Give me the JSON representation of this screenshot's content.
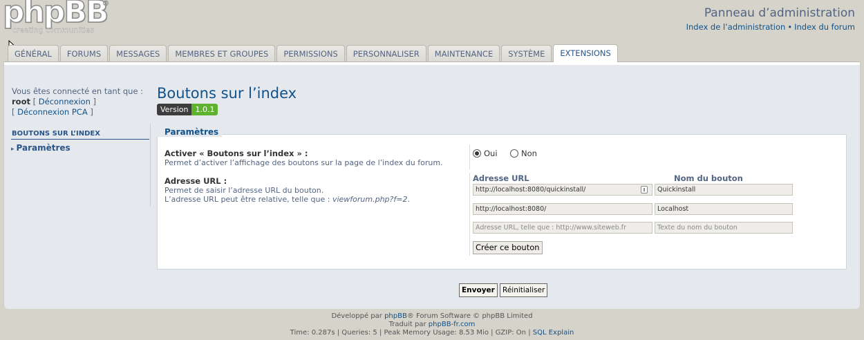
{
  "header": {
    "logo_text": "phpBB",
    "logo_reg": "®",
    "logo_tagline": "creating  communities",
    "title": "Panneau d’administration",
    "links": [
      "Index de l’administration",
      "Index du forum"
    ],
    "link_sep": "•"
  },
  "tabs": [
    {
      "label": "GÉNÉRAL",
      "active": false
    },
    {
      "label": "FORUMS",
      "active": false
    },
    {
      "label": "MESSAGES",
      "active": false
    },
    {
      "label": "MEMBRES ET GROUPES",
      "active": false
    },
    {
      "label": "PERMISSIONS",
      "active": false
    },
    {
      "label": "PERSONNALISER",
      "active": false
    },
    {
      "label": "MAINTENANCE",
      "active": false
    },
    {
      "label": "SYSTÈME",
      "active": false
    },
    {
      "label": "EXTENSIONS",
      "active": true
    }
  ],
  "sidebar": {
    "connected_as": "Vous êtes connecté en tant que :",
    "username": "root",
    "logout": "Déconnexion",
    "logout_acp": "Déconnexion PCA",
    "menu_title": "BOUTONS SUR L’INDEX",
    "menu_item": "Paramètres"
  },
  "main": {
    "title": "Boutons sur l’index",
    "version_label": "Version",
    "version_number": "1.0.1",
    "legend": "Paramètres",
    "enable": {
      "label": "Activer « Boutons sur l’index » :",
      "explain": "Permet d’activer l’affichage des boutons sur la page de l’index du forum.",
      "options": [
        "Oui",
        "Non"
      ],
      "selected": "Oui"
    },
    "url": {
      "label": "Adresse URL :",
      "explain_1": "Permet de saisir l’adresse URL du bouton.",
      "explain_2": "L’adresse URL peut être relative, telle que :",
      "explain_example": "viewforum.php?f=2",
      "explain_end": "."
    },
    "columns": {
      "url": "Adresse URL",
      "name": "Nom du bouton"
    },
    "rows": [
      {
        "url": "http://localhost:8080/quickinstall/",
        "name": "Quickinstall"
      },
      {
        "url": "http://localhost:8080/",
        "name": "Localhost"
      }
    ],
    "placeholders": {
      "url": "Adresse URL, telle que : http://www.siteweb.fr",
      "name": "Texte du nom du bouton"
    },
    "create_button": "Créer ce bouton",
    "submit": "Envoyer",
    "reset": "Réinitialiser"
  },
  "footer": {
    "line1_pre": "Développé par ",
    "line1_link": "phpBB",
    "line1_post": "® Forum Software © phpBB Limited",
    "line2_pre": "Traduit par ",
    "line2_link": "phpBB-fr.com",
    "line3": "Time: 0.287s | Queries: 5 | Peak Memory Usage: 8.53 Mio | GZIP: On | ",
    "line3_link": "SQL Explain"
  }
}
